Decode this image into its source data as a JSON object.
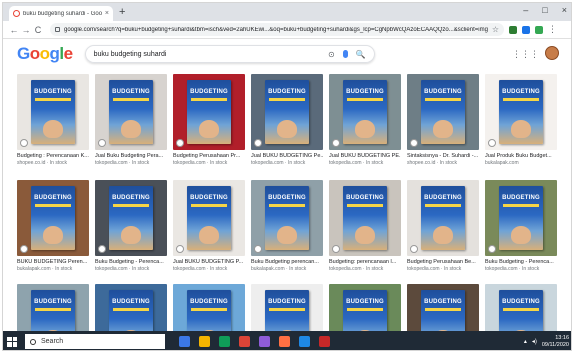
{
  "browser": {
    "tab_title": "buku budgeting suhardi - Goog",
    "tab_close": "×",
    "new_tab": "+",
    "window_controls": [
      "–",
      "□",
      "×"
    ],
    "nav": {
      "back": "←",
      "forward": "→",
      "reload": "C"
    },
    "url": "google.com/search?q=buku+budgeting+suhardi&tbm=isch&ved=2ahUKEwi...&oq=buku+budgeting+suhardi&gs_lcp=CgNpbWcQAzoECAAQQzo...&sclient=img",
    "star": "☆",
    "extension_colors": [
      "#2e7d32",
      "#1a73e8",
      "#34a853"
    ],
    "menu_dots": "⋮"
  },
  "google": {
    "logo_letters": [
      "G",
      "o",
      "o",
      "g",
      "l",
      "e"
    ],
    "query": "buku budgeting suhardi",
    "icons": {
      "camera": "⊙",
      "search": "🔍",
      "apps": "⋮⋮⋮"
    }
  },
  "results": {
    "book_title": "BUDGETING",
    "rows": [
      [
        {
          "caption": "Budgeting : Perencanaan K...",
          "source": "shopee.co.id · In stock",
          "bg": "#e9e6e2"
        },
        {
          "caption": "Jual Buku Budgeting Pera...",
          "source": "tokopedia.com · In stock",
          "bg": "#d7d3cf"
        },
        {
          "caption": "Budgeting Perusahaan Pr...",
          "source": "tokopedia.com · In stock",
          "bg": "#b11f2a"
        },
        {
          "caption": "Jual BUKU BUDGETING Pe...",
          "source": "tokopedia.com · In stock",
          "bg": "#5a6a7a"
        },
        {
          "caption": "Jual BUKU BUDGETING PE...",
          "source": "tokopedia.com · In stock",
          "bg": "#7e8f93"
        },
        {
          "caption": "Sintaksisnya - Dr. Suhardi -...",
          "source": "shopee.co.id · In stock",
          "bg": "#6e7e86"
        },
        {
          "caption": "Jual Produk Buku Budget...",
          "source": "bukalapak.com",
          "bg": "#f4f1ee"
        }
      ],
      [
        {
          "caption": "BUKU BUDGETING Peren...",
          "source": "bukalapak.com · In stock",
          "bg": "#8a5a3a"
        },
        {
          "caption": "Buku Budgeting - Perenca...",
          "source": "tokopedia.com · In stock",
          "bg": "#4a5058"
        },
        {
          "caption": "Jual BUKU BUDGETING P...",
          "source": "tokopedia.com · In stock",
          "bg": "#eae7e3"
        },
        {
          "caption": "Buku Budgeting perencan...",
          "source": "bukalapak.com · In stock",
          "bg": "#8fa0a8"
        },
        {
          "caption": "Budgeting: perencanaan l...",
          "source": "tokopedia.com · In stock",
          "bg": "#c9c4bd"
        },
        {
          "caption": "Budgeting Perusahaan Be...",
          "source": "tokopedia.com · In stock",
          "bg": "#e4e1dd"
        },
        {
          "caption": "Buku Budgeting - Perenca...",
          "source": "tokopedia.com · In stock",
          "bg": "#7a8a5a"
        }
      ],
      [
        {
          "caption": "",
          "source": "",
          "bg": "#8ea3ad"
        },
        {
          "caption": "",
          "source": "",
          "bg": "#3d6a9a"
        },
        {
          "caption": "",
          "source": "",
          "bg": "#6da8d8"
        },
        {
          "caption": "",
          "source": "",
          "bg": "#eeeeee"
        },
        {
          "caption": "",
          "source": "",
          "bg": "#6a8a5a"
        },
        {
          "caption": "",
          "source": "",
          "bg": "#5c4a3c"
        },
        {
          "caption": "",
          "source": "",
          "bg": "#c9d6dd"
        }
      ]
    ]
  },
  "taskbar": {
    "search_placeholder": "Search",
    "app_colors": [
      "#3b78e7",
      "#f4b400",
      "#0f9d58",
      "#db4437",
      "#8e5cd9",
      "#ff7043",
      "#1e88e5",
      "#c62828"
    ],
    "time": "13:16",
    "date": "09/11/2020"
  }
}
